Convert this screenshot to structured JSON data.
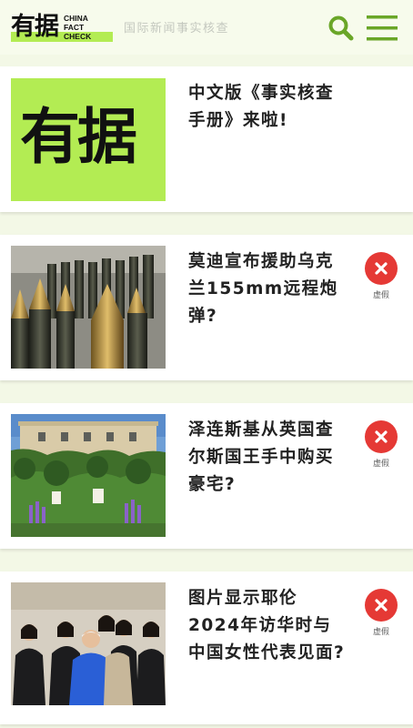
{
  "header": {
    "logo_cn": "有据",
    "logo_en": [
      "CHINA",
      "FACT",
      "CHECK"
    ],
    "tagline": "国际新闻事实核查",
    "search_icon": "search-icon",
    "menu_icon": "hamburger-menu-icon"
  },
  "articles": [
    {
      "title": "中文版《事实核查手册》来啦!",
      "thumb_text": "有据",
      "verdict": ""
    },
    {
      "title": "莫迪宣布援助乌克兰155mm远程炮弹?",
      "verdict": "虚假"
    },
    {
      "title": "泽连斯基从英国查尔斯国王手中购买豪宅?",
      "verdict": "虚假"
    },
    {
      "title": "图片显示耶伦2024年访华时与中国女性代表见面?",
      "verdict": "虚假"
    }
  ],
  "colors": {
    "brand_green": "#b3ec53",
    "icon_green": "#6aa628",
    "false_red": "#e53935",
    "page_bg": "#f3f8e6"
  }
}
